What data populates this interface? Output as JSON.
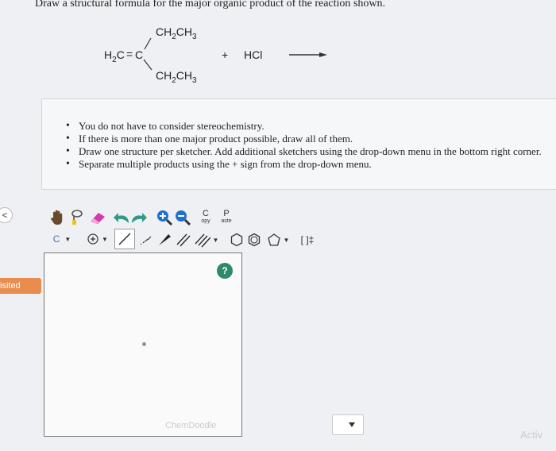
{
  "question": "Draw a structural formula for the major organic product of the reaction shown.",
  "reaction": {
    "top_group": "CH2CH3",
    "left_group": "H2C",
    "double_bond": "=",
    "center_atom": "C",
    "bottom_group": "CH2CH3",
    "plus": "+",
    "reagent": "HCl"
  },
  "instructions": [
    "You do not have to consider stereochemistry.",
    "If there is more than one major product possible, draw all of them.",
    "Draw one structure per sketcher. Add additional sketchers using the drop-down menu in the bottom right corner.",
    "Separate multiple products using the + sign from the drop-down menu."
  ],
  "side_tab_symbol": "<",
  "visited_label": "isited",
  "toolbar": {
    "copy_label_top": "C",
    "copy_label_bottom": "opy",
    "paste_label_top": "P",
    "paste_label_bottom": "aste",
    "element_label": "C",
    "bracket_label": "[ ]‡"
  },
  "help_label": "?",
  "watermark": "ChemDoodle",
  "activate_text": "Activ",
  "colors": {
    "accent": "#e98d4e",
    "help": "#2e8a6b",
    "zoom": "#1f6fd1"
  }
}
